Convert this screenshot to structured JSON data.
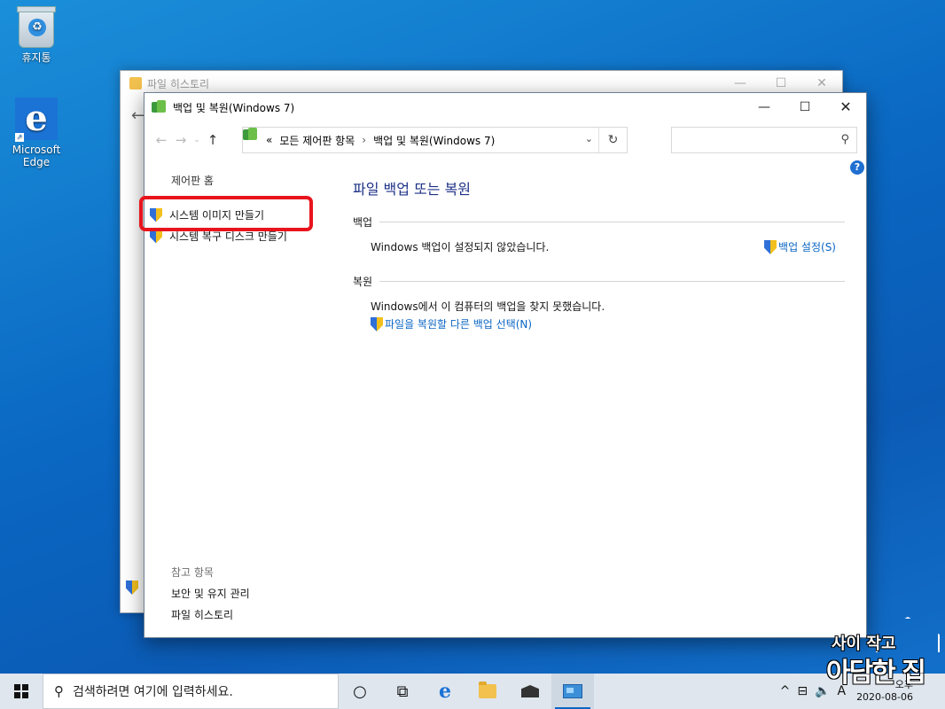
{
  "desktop": {
    "icons": [
      {
        "label": "휴지통",
        "icon": "recycle-bin-icon"
      },
      {
        "label": "Microsoft Edge",
        "icon": "edge-icon"
      }
    ]
  },
  "back_window": {
    "title": "파일 히스토리"
  },
  "window": {
    "title": "백업 및 복원(Windows 7)",
    "address": {
      "prefix": "«",
      "crumb1": "모든 제어판 항목",
      "separator": "›",
      "crumb2": "백업 및 복원(Windows 7)"
    },
    "search_placeholder": "",
    "sidebar": {
      "home": "제어판 홈",
      "links": [
        "시스템 이미지 만들기",
        "시스템 복구 디스크 만들기"
      ],
      "see_also_title": "참고 항목",
      "see_also": [
        "보안 및 유지 관리",
        "파일 히스토리"
      ]
    },
    "main": {
      "heading": "파일 백업 또는 복원",
      "backup": {
        "title": "백업",
        "status": "Windows 백업이 설정되지 않았습니다.",
        "action": "백업 설정(S)"
      },
      "restore": {
        "title": "복원",
        "status": "Windows에서 이 컴퓨터의 백업을 찾지 못했습니다.",
        "action": "파일을 복원할 다른 백업 선택(N)"
      }
    }
  },
  "taskbar": {
    "search_placeholder": "검색하려면 여기에 입력하세요.",
    "tray": {
      "chevron": "^",
      "ime": "A",
      "time": "오후",
      "date": "2020-08-06"
    }
  },
  "watermark": {
    "line1": "사이 작고",
    "line2": "아담한 집"
  },
  "colors": {
    "link": "#0b66c4",
    "heading": "#1e3287",
    "highlight": "#e8141c",
    "desktop": "#0a67c2"
  }
}
